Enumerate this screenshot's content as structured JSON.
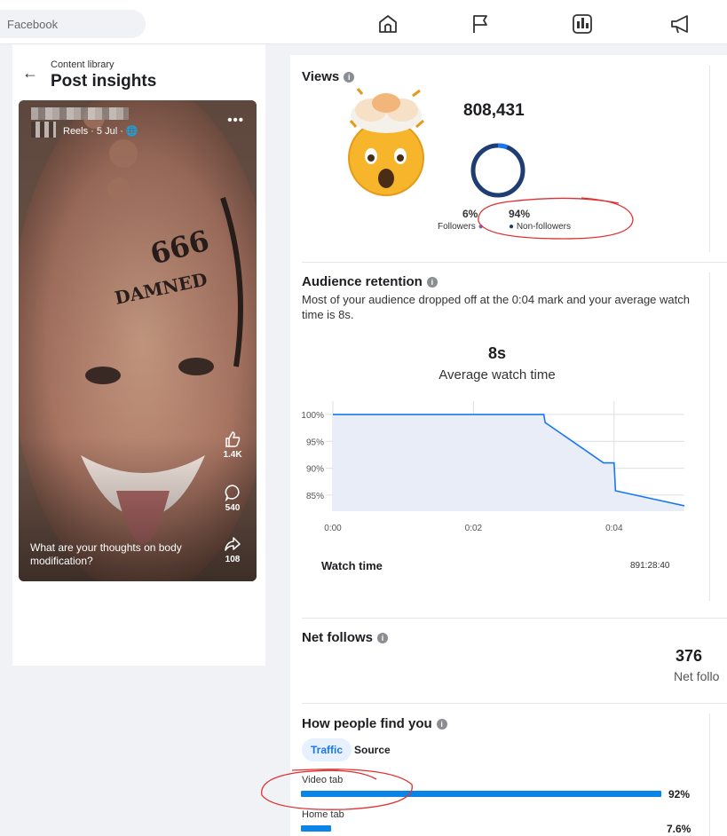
{
  "topbar": {
    "search_placeholder": "Facebook",
    "nav_icons": [
      "home-icon",
      "flag-icon",
      "insights-icon",
      "megaphone-icon"
    ]
  },
  "left": {
    "breadcrumb": "Content library",
    "title": "Post insights"
  },
  "reel": {
    "meta": "Reels · 5 Jul · ",
    "caption": "What are your thoughts on body modification?",
    "likes": "1.4K",
    "comments": "540",
    "shares": "108"
  },
  "views": {
    "title": "Views",
    "total": "808,431",
    "followers_pct": "6%",
    "followers_label": "Followers",
    "nonfollowers_pct": "94%",
    "nonfollowers_label": "Non-followers",
    "followers_fraction": 0.06,
    "colors": {
      "followers": "#1877f2",
      "nonfollowers": "#1d3d73"
    }
  },
  "retention": {
    "title": "Audience retention",
    "desc": "Most of your audience dropped off at the 0:04 mark and your average watch time is 8s.",
    "avg_value": "8s",
    "avg_label": "Average watch time",
    "watch_time_label": "Watch time",
    "watch_time_value": "891:28:40"
  },
  "chart_data": {
    "type": "line",
    "xlabel": "",
    "ylabel": "",
    "x_ticks": [
      "0:00",
      "0:02",
      "0:04"
    ],
    "y_ticks": [
      "100%",
      "95%",
      "90%",
      "85%"
    ],
    "ylim": [
      82,
      100.5
    ],
    "xlim": [
      0,
      5
    ],
    "series": [
      {
        "x": [
          0,
          3.0,
          3.02,
          3.85,
          4.0,
          4.02,
          5.0
        ],
        "y": [
          100,
          100,
          98.5,
          91,
          91,
          85.8,
          83
        ]
      }
    ],
    "line_color": "#1877f2",
    "fill_color": "#e8edf8"
  },
  "net_follows": {
    "title": "Net follows",
    "value": "376",
    "label": "Net follo"
  },
  "find": {
    "title": "How people find you",
    "tabs": [
      "Traffic",
      "Source"
    ],
    "rows": [
      {
        "label": "Video tab",
        "value": "92%",
        "fraction": 0.92
      },
      {
        "label": "Home tab",
        "value": "7.6%",
        "fraction": 0.076
      }
    ]
  }
}
